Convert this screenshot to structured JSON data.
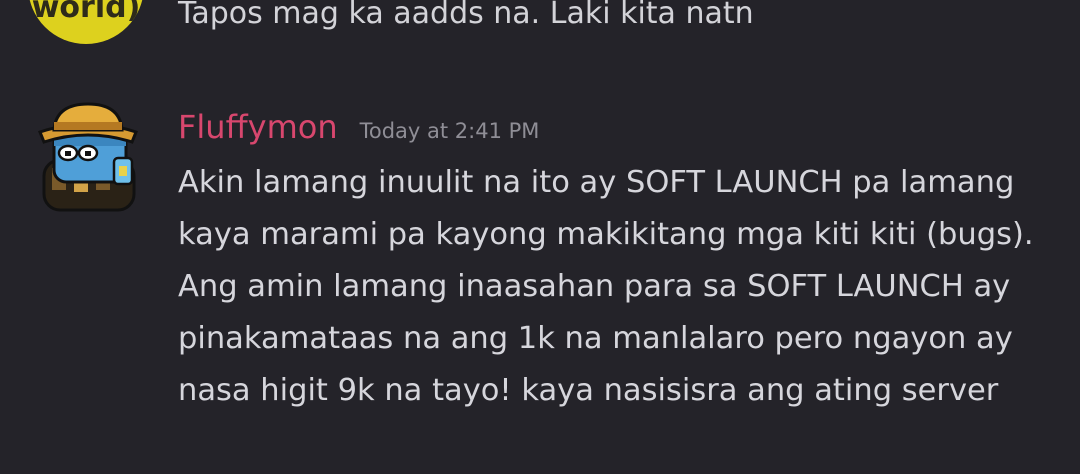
{
  "previous_message": {
    "avatar_text": "world)",
    "text": "Tapos mag ka aadds na. Laki kita natn"
  },
  "message": {
    "username": "Fluffymon",
    "timestamp": "Today at 2:41 PM",
    "lines": [
      "Akin lamang inuulit na ito ay SOFT LAUNCH pa lamang",
      "kaya marami pa kayong makikitang mga kiti kiti (bugs).",
      "Ang amin lamang inaasahan para sa SOFT LAUNCH ay",
      "pinakamataas na ang 1k na manlalaro pero ngayon ay",
      "nasa higit 9k na tayo! kaya nasisisra ang ating server"
    ]
  },
  "colors": {
    "background": "#242329",
    "username": "#d8476e",
    "timestamp": "#8f8e96",
    "text": "#d6d6dc",
    "prev_avatar": "#ddd11e"
  }
}
